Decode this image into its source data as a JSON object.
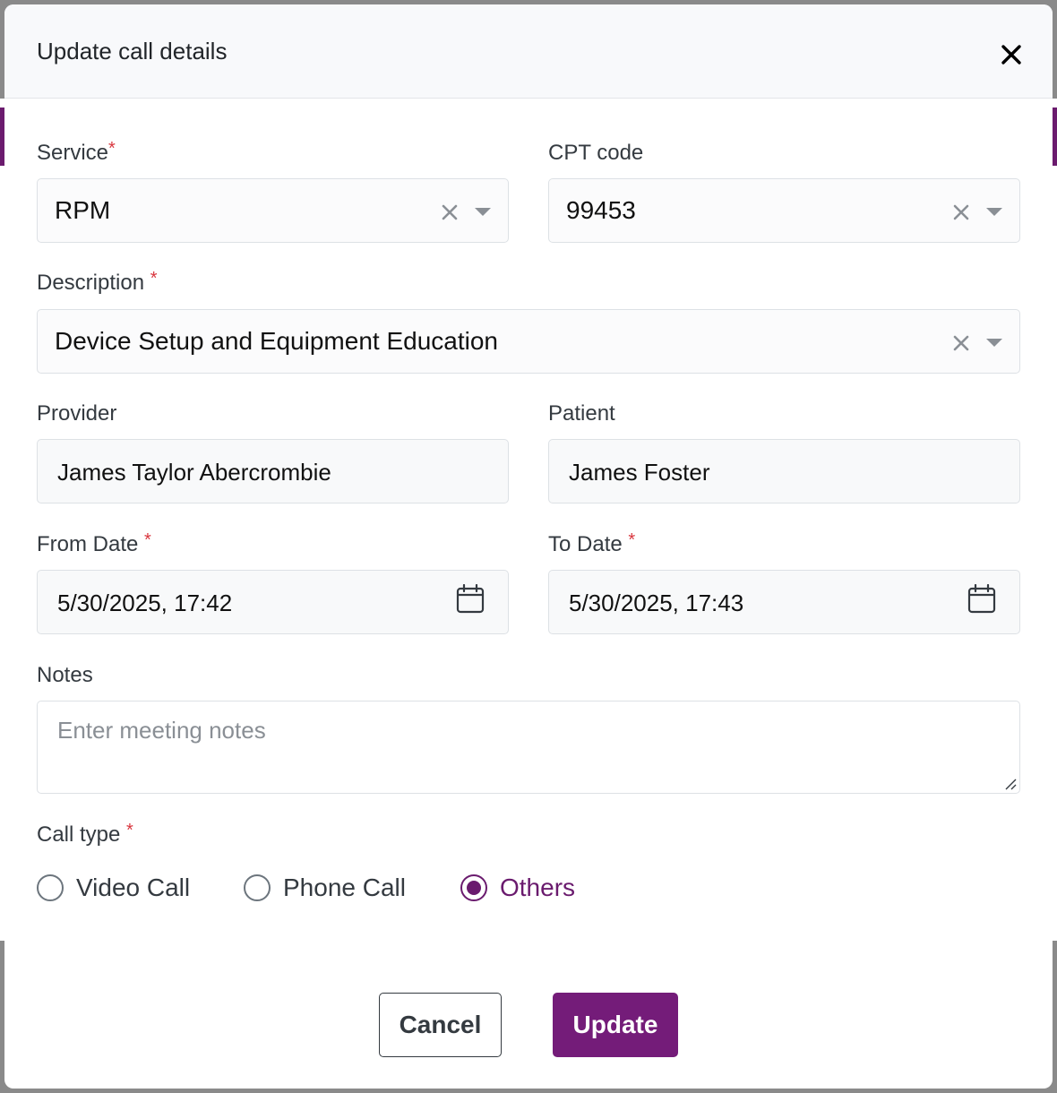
{
  "modal": {
    "title": "Update call details"
  },
  "fields": {
    "service": {
      "label": "Service",
      "value": "RPM"
    },
    "cpt_code": {
      "label": "CPT code",
      "value": "99453"
    },
    "description": {
      "label": "Description",
      "value": "Device Setup and Equipment Education"
    },
    "provider": {
      "label": "Provider",
      "value": "James Taylor Abercrombie"
    },
    "patient": {
      "label": "Patient",
      "value": "James Foster"
    },
    "from_date": {
      "label": "From Date",
      "value": "5/30/2025, 17:42"
    },
    "to_date": {
      "label": "To Date",
      "value": "5/30/2025, 17:43"
    },
    "notes": {
      "label": "Notes",
      "placeholder": "Enter meeting notes"
    }
  },
  "call_type": {
    "label": "Call type",
    "options": [
      {
        "label": "Video Call",
        "checked": false
      },
      {
        "label": "Phone Call",
        "checked": false
      },
      {
        "label": "Others",
        "checked": true
      }
    ]
  },
  "actions": {
    "cancel_label": "Cancel",
    "update_label": "Update"
  },
  "required_marker": "*",
  "colors": {
    "accent": "#741c79",
    "required": "#d9363e"
  },
  "icons": [
    "close-icon",
    "clear-icon",
    "chevron-down-icon",
    "calendar-icon"
  ]
}
